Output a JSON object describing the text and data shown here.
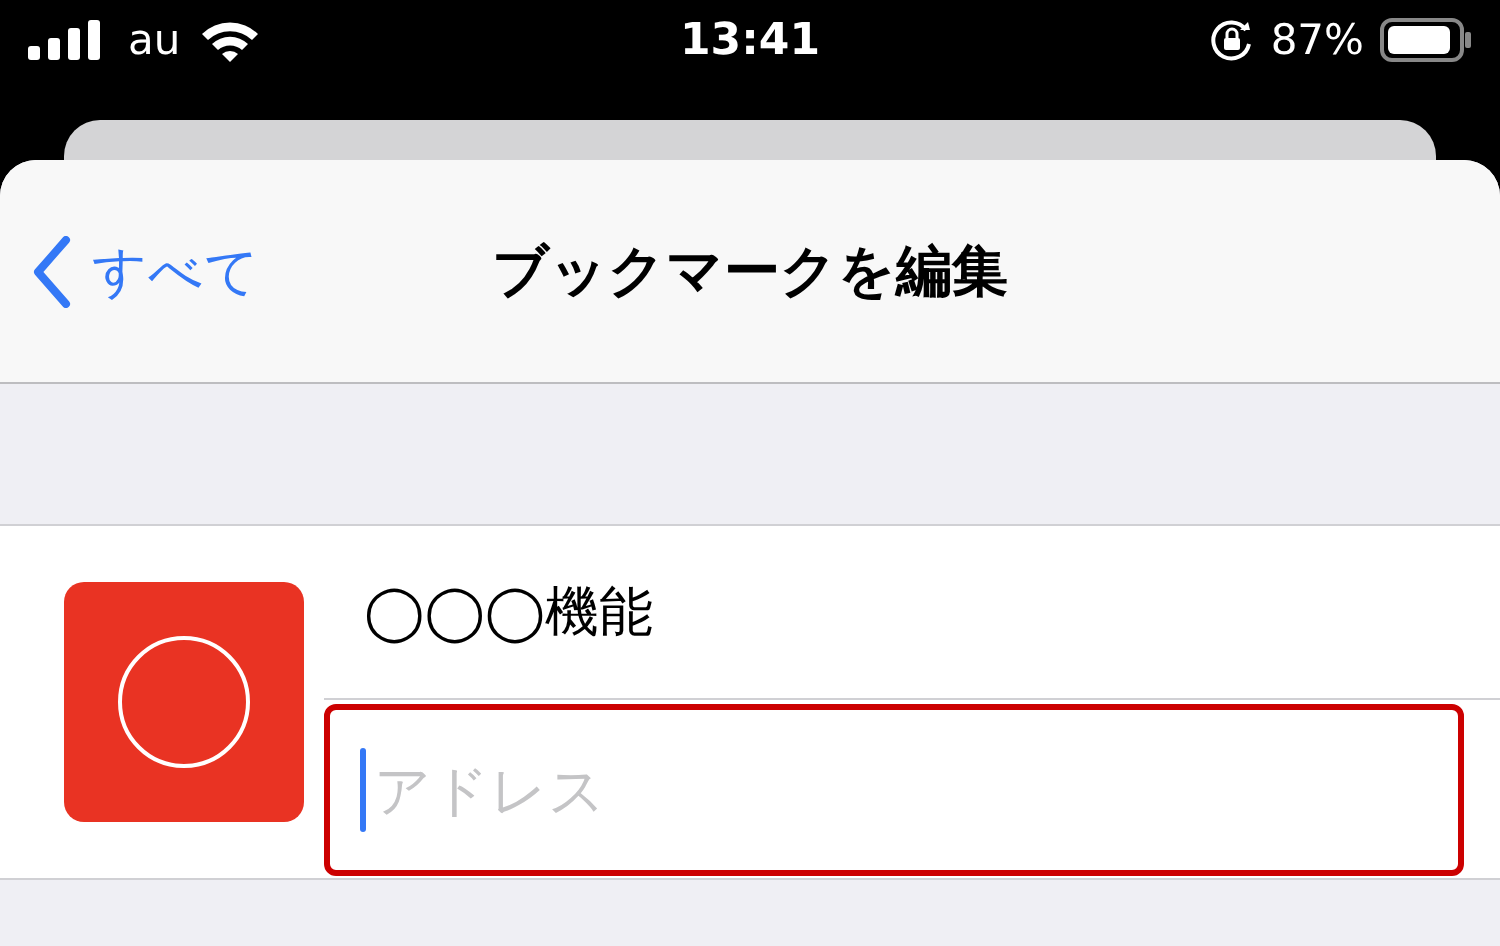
{
  "status_bar": {
    "carrier": "au",
    "time": "13:41",
    "battery": "87%"
  },
  "nav_bar": {
    "back_label": "すべて",
    "title": "ブックマークを編集"
  },
  "bookmark": {
    "title": "◯◯◯機能",
    "address": {
      "placeholder": "アドレス"
    }
  }
}
